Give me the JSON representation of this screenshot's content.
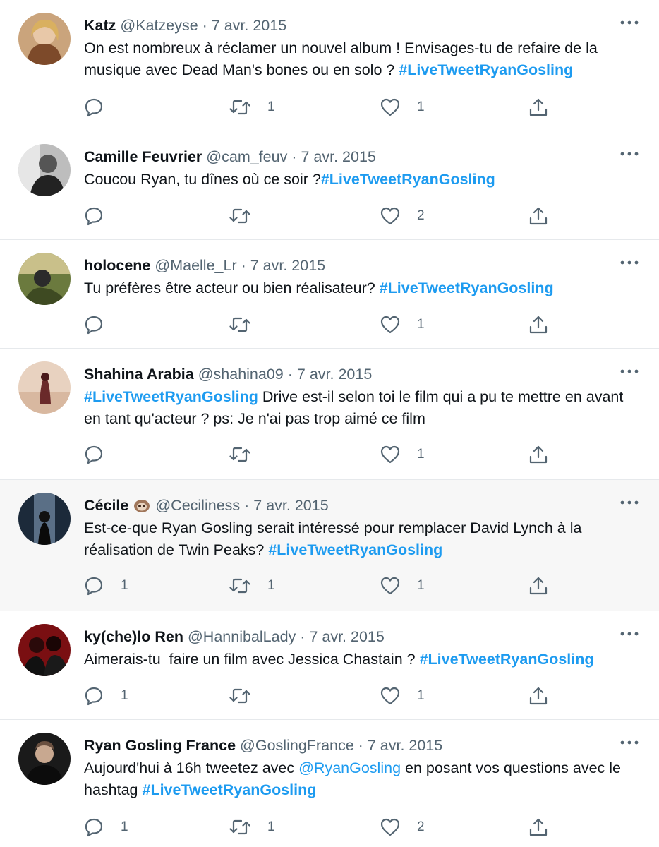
{
  "tweets": [
    {
      "name": "Katz",
      "handle": "@Katzeyse",
      "sep": "·",
      "date": "7 avr. 2015",
      "text1": "On est nombreux à réclamer un nouvel album ! Envisages-tu de refaire de la musique avec Dead Man's bones ou en solo ? ",
      "hashtag": "#LiveTweetRyanGosling",
      "replies": "",
      "retweets": "1",
      "likes": "1"
    },
    {
      "name": "Camille Feuvrier",
      "handle": "@cam_feuv",
      "sep": "·",
      "date": "7 avr. 2015",
      "text1": "Coucou Ryan, tu dînes où ce soir ?",
      "hashtag": "#LiveTweetRyanGosling",
      "replies": "",
      "retweets": "",
      "likes": "2"
    },
    {
      "name": "holocene",
      "handle": "@Maelle_Lr",
      "sep": "·",
      "date": "7 avr. 2015",
      "text1": "Tu préfères être acteur ou bien réalisateur? ",
      "hashtag": "#LiveTweetRyanGosling",
      "replies": "",
      "retweets": "",
      "likes": "1"
    },
    {
      "name": "Shahina Arabia",
      "handle": "@shahina09",
      "sep": "·",
      "date": "7 avr. 2015",
      "hashtag": "#LiveTweetRyanGosling",
      "text2": " Drive est-il selon toi le film qui a pu te mettre en avant en tant qu'acteur ? ps: Je n'ai pas trop aimé ce film",
      "replies": "",
      "retweets": "",
      "likes": "1"
    },
    {
      "name": "Cécile",
      "emoji": "sloth-emoji",
      "handle": "@Ceciliness",
      "sep": "·",
      "date": "7 avr. 2015",
      "text1": "Est-ce-que Ryan Gosling serait intéressé pour remplacer David Lynch à la réalisation de Twin Peaks? ",
      "hashtag": "#LiveTweetRyanGosling",
      "replies": "1",
      "retweets": "1",
      "likes": "1"
    },
    {
      "name": "ky(che)lo Ren",
      "handle": "@HannibalLady",
      "sep": "·",
      "date": "7 avr. 2015",
      "text1": "Aimerais-tu  faire un film avec Jessica Chastain ? ",
      "hashtag": "#LiveTweetRyanGosling",
      "replies": "1",
      "retweets": "",
      "likes": "1"
    },
    {
      "name": "Ryan Gosling France",
      "handle": "@GoslingFrance",
      "sep": "·",
      "date": "7 avr. 2015",
      "text1": "Aujourd'hui à 16h tweetez avec ",
      "mention": "@RyanGosling",
      "text2": " en posant vos questions avec le hashtag ",
      "hashtag": "#LiveTweetRyanGosling",
      "replies": "1",
      "retweets": "1",
      "likes": "2"
    }
  ],
  "icons": {
    "reply": "reply-icon",
    "retweet": "retweet-icon",
    "like": "heart-icon",
    "share": "share-icon",
    "more": "more-icon"
  },
  "colors": {
    "accent": "#1d9bf0",
    "muted": "#536471",
    "text": "#0f1419",
    "highlight_bg": "#f7f7f7",
    "divider": "#e6e9ec"
  }
}
